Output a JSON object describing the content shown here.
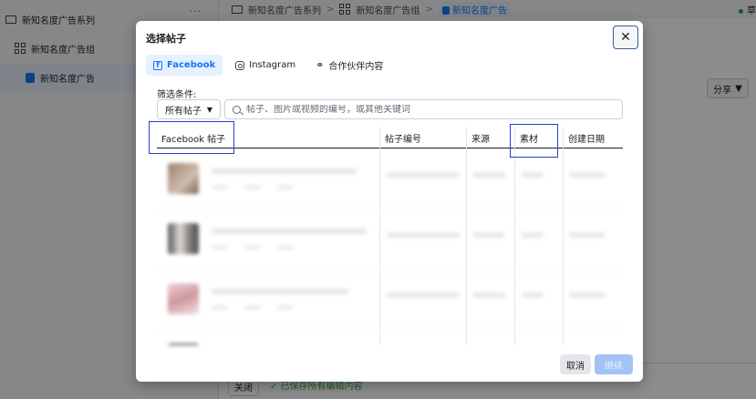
{
  "background": {
    "sidebar": {
      "campaign": "新知名度广告系列",
      "more": "···",
      "adset": "新知名度广告组",
      "ad": "新知名度广告"
    },
    "breadcrumb": [
      "新知名度广告系列",
      "新知名度广告组",
      "新知名度广告"
    ],
    "breadcrumb_sep": ">",
    "status": "草",
    "share_label": "分享",
    "close_label": "关闭",
    "saved_text": "✓ 已保存所有编辑内容"
  },
  "modal": {
    "title": "选择帖子",
    "close_glyph": "✕",
    "tabs": [
      {
        "label": "Facebook",
        "active": true
      },
      {
        "label": "Instagram",
        "active": false
      },
      {
        "label": "合作伙伴内容",
        "active": false
      }
    ],
    "filter": {
      "label": "筛选条件:",
      "selected": "所有帖子",
      "search_placeholder": "帖子、图片或视频的编号，或其他关键词"
    },
    "table": {
      "headers": [
        "Facebook 帖子",
        "帖子编号",
        "来源",
        "素材",
        "创建日期"
      ]
    },
    "footer": {
      "cancel": "取消",
      "continue": "继续"
    }
  },
  "colors": {
    "accent": "#1877f2",
    "highlight_box": "#2c3ad6",
    "continue_disabled": "#a3c3f5"
  }
}
